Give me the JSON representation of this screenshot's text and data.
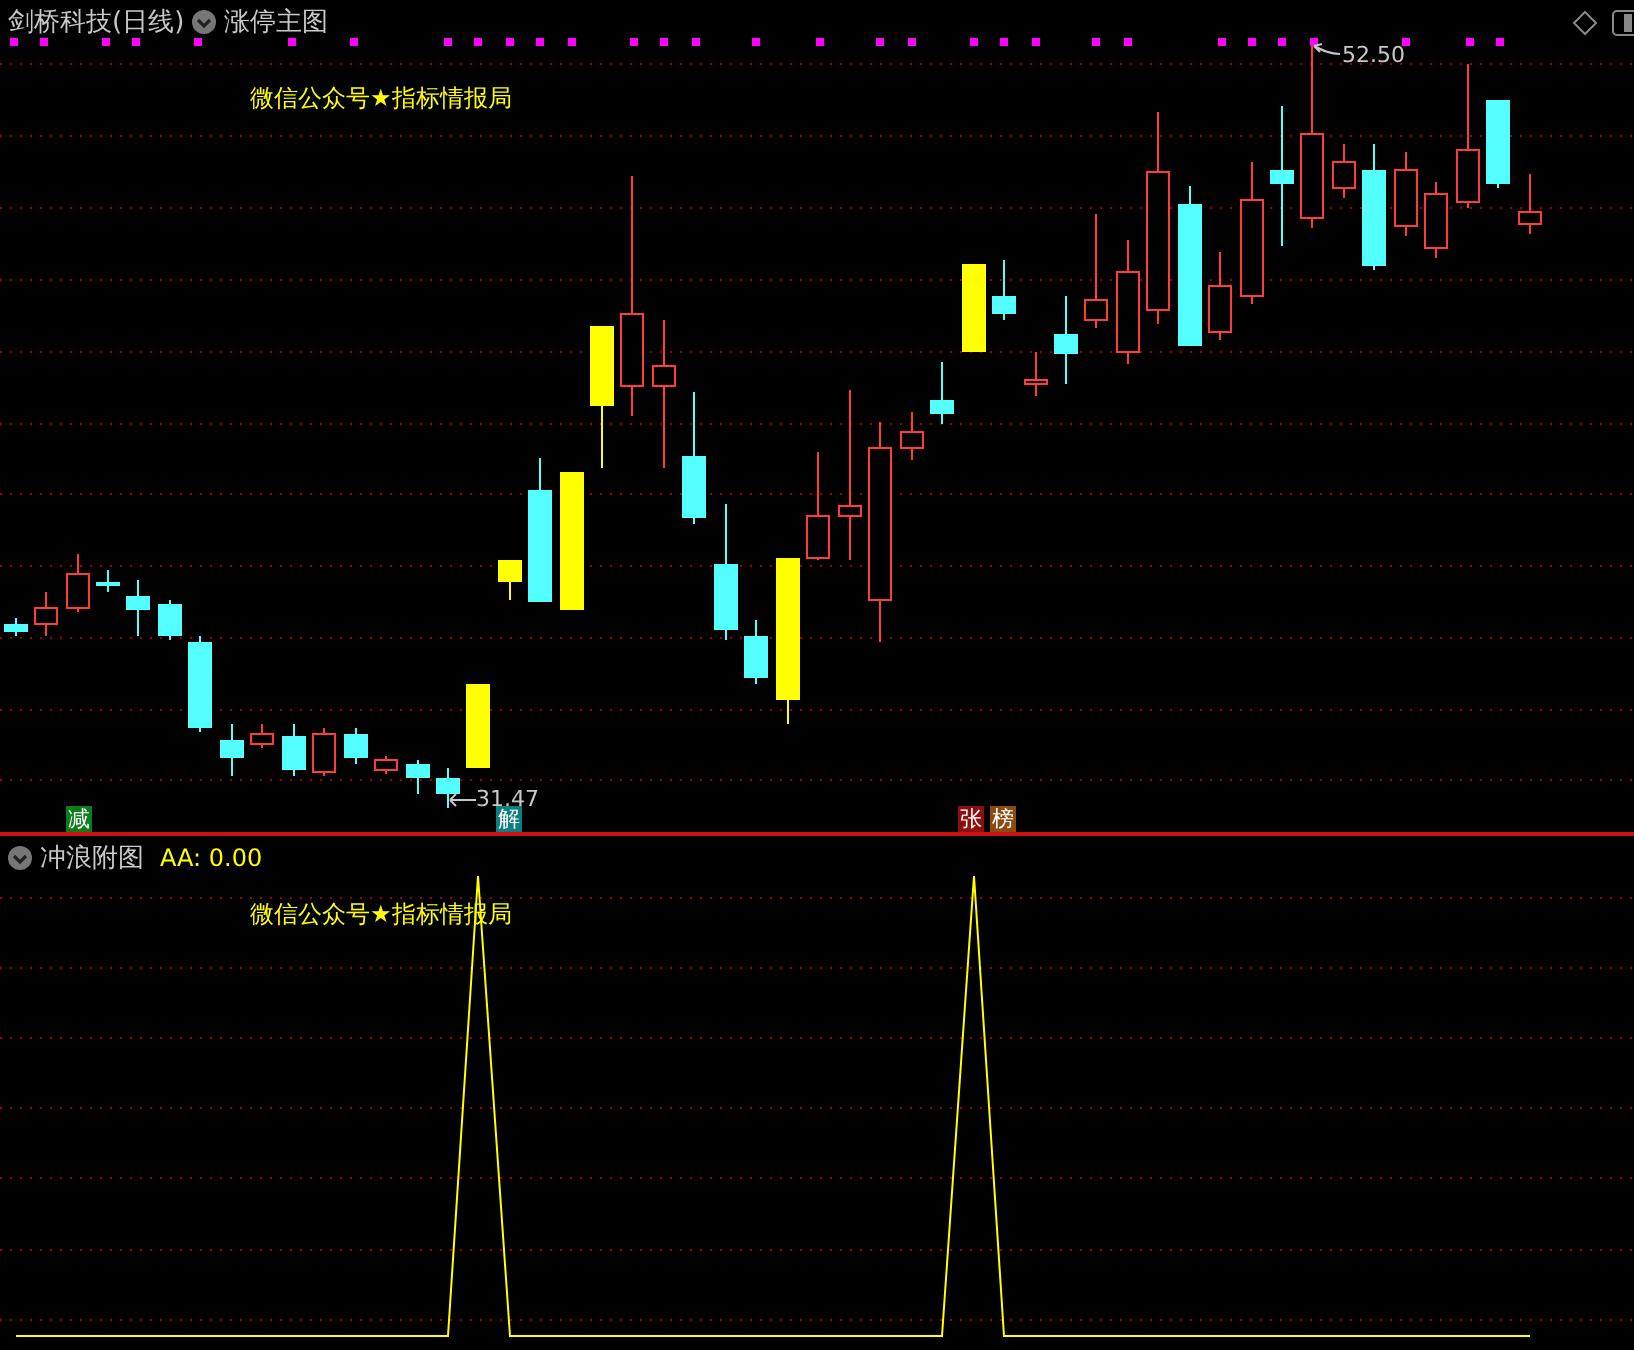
{
  "main_chart": {
    "title": "剑桥科技(日线)",
    "indicator": "涨停主图",
    "overlay_text": "微信公众号★指标情报局",
    "high_label": "52.50",
    "low_label": "31.47",
    "signals": [
      {
        "text": "减",
        "color": "#0b7d1c"
      },
      {
        "text": "解",
        "color": "#0e7f80"
      },
      {
        "text": "张",
        "color": "#8a1010"
      },
      {
        "text": "榜",
        "color": "#8a4a10"
      }
    ]
  },
  "sub_chart": {
    "title": "冲浪附图",
    "reading": "AA: 0.00",
    "overlay_text": "微信公众号★指标情报局"
  }
}
